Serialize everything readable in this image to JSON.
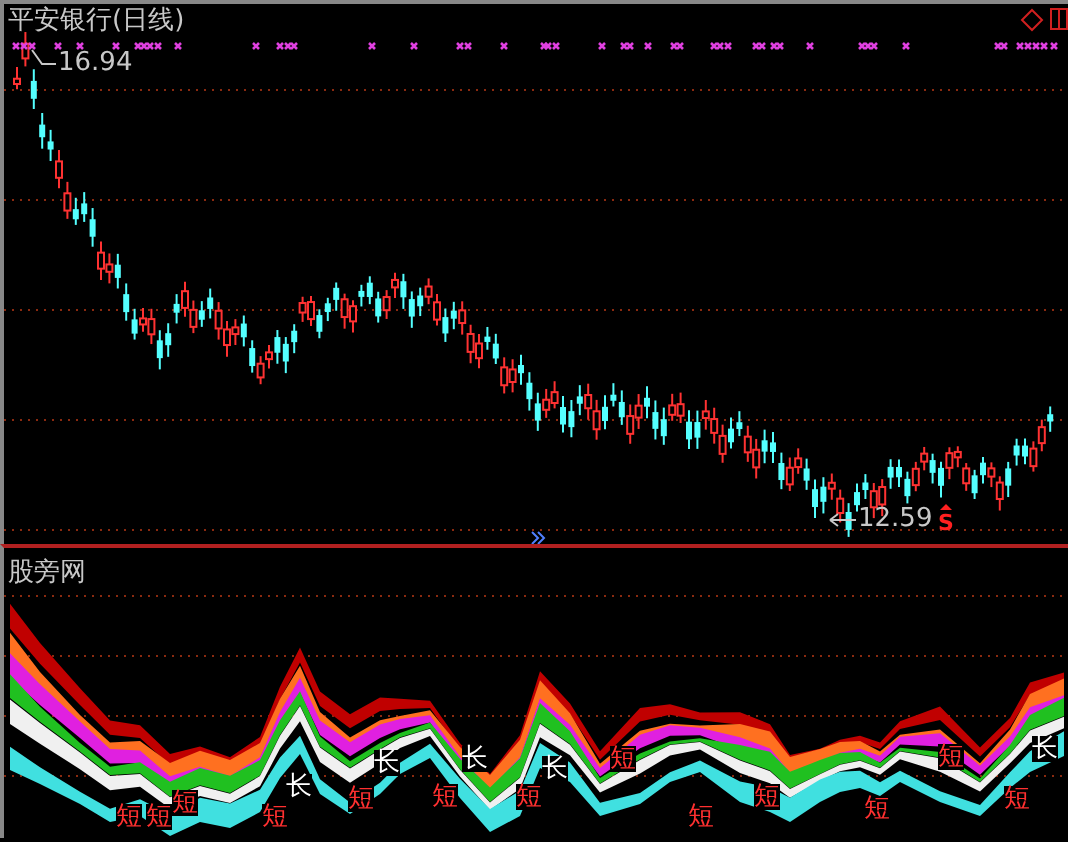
{
  "upper_pane": {
    "title": "平安银行(日线)",
    "high_label": "16.94",
    "low_label": "12.59",
    "sell_signal": "S"
  },
  "lower_pane": {
    "title": "股旁网",
    "signals": [
      {
        "text": "短",
        "kind": "short"
      },
      {
        "text": "短",
        "kind": "short"
      },
      {
        "text": "短",
        "kind": "short"
      },
      {
        "text": "短",
        "kind": "short"
      },
      {
        "text": "长",
        "kind": "long"
      },
      {
        "text": "短",
        "kind": "short"
      },
      {
        "text": "长",
        "kind": "long"
      },
      {
        "text": "短",
        "kind": "short"
      },
      {
        "text": "长",
        "kind": "long"
      },
      {
        "text": "短",
        "kind": "short"
      },
      {
        "text": "长",
        "kind": "long"
      },
      {
        "text": "短",
        "kind": "short"
      },
      {
        "text": "短",
        "kind": "short"
      },
      {
        "text": "短",
        "kind": "short"
      },
      {
        "text": "短",
        "kind": "short"
      },
      {
        "text": "短",
        "kind": "short"
      },
      {
        "text": "短",
        "kind": "short"
      },
      {
        "text": "长",
        "kind": "long"
      }
    ]
  }
}
